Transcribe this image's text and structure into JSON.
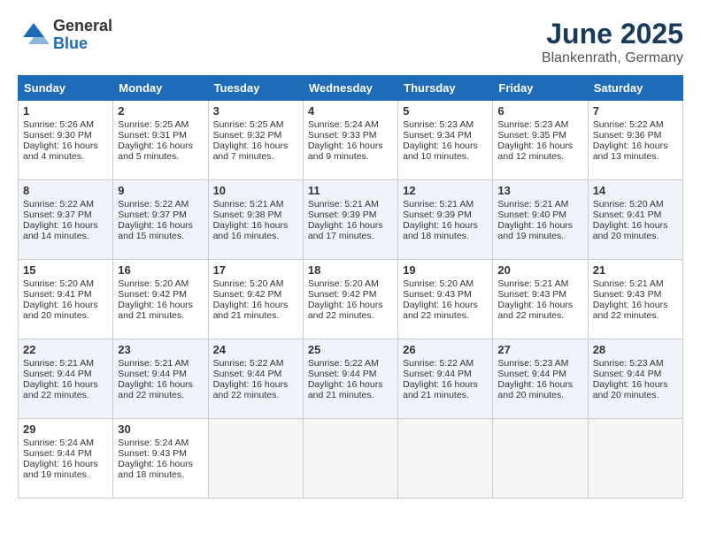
{
  "header": {
    "logo_general": "General",
    "logo_blue": "Blue",
    "month_title": "June 2025",
    "location": "Blankenrath, Germany"
  },
  "days_of_week": [
    "Sunday",
    "Monday",
    "Tuesday",
    "Wednesday",
    "Thursday",
    "Friday",
    "Saturday"
  ],
  "weeks": [
    [
      {
        "day": 1,
        "lines": [
          "Sunrise: 5:26 AM",
          "Sunset: 9:30 PM",
          "Daylight: 16 hours",
          "and 4 minutes."
        ]
      },
      {
        "day": 2,
        "lines": [
          "Sunrise: 5:25 AM",
          "Sunset: 9:31 PM",
          "Daylight: 16 hours",
          "and 5 minutes."
        ]
      },
      {
        "day": 3,
        "lines": [
          "Sunrise: 5:25 AM",
          "Sunset: 9:32 PM",
          "Daylight: 16 hours",
          "and 7 minutes."
        ]
      },
      {
        "day": 4,
        "lines": [
          "Sunrise: 5:24 AM",
          "Sunset: 9:33 PM",
          "Daylight: 16 hours",
          "and 9 minutes."
        ]
      },
      {
        "day": 5,
        "lines": [
          "Sunrise: 5:23 AM",
          "Sunset: 9:34 PM",
          "Daylight: 16 hours",
          "and 10 minutes."
        ]
      },
      {
        "day": 6,
        "lines": [
          "Sunrise: 5:23 AM",
          "Sunset: 9:35 PM",
          "Daylight: 16 hours",
          "and 12 minutes."
        ]
      },
      {
        "day": 7,
        "lines": [
          "Sunrise: 5:22 AM",
          "Sunset: 9:36 PM",
          "Daylight: 16 hours",
          "and 13 minutes."
        ]
      }
    ],
    [
      {
        "day": 8,
        "lines": [
          "Sunrise: 5:22 AM",
          "Sunset: 9:37 PM",
          "Daylight: 16 hours",
          "and 14 minutes."
        ]
      },
      {
        "day": 9,
        "lines": [
          "Sunrise: 5:22 AM",
          "Sunset: 9:37 PM",
          "Daylight: 16 hours",
          "and 15 minutes."
        ]
      },
      {
        "day": 10,
        "lines": [
          "Sunrise: 5:21 AM",
          "Sunset: 9:38 PM",
          "Daylight: 16 hours",
          "and 16 minutes."
        ]
      },
      {
        "day": 11,
        "lines": [
          "Sunrise: 5:21 AM",
          "Sunset: 9:39 PM",
          "Daylight: 16 hours",
          "and 17 minutes."
        ]
      },
      {
        "day": 12,
        "lines": [
          "Sunrise: 5:21 AM",
          "Sunset: 9:39 PM",
          "Daylight: 16 hours",
          "and 18 minutes."
        ]
      },
      {
        "day": 13,
        "lines": [
          "Sunrise: 5:21 AM",
          "Sunset: 9:40 PM",
          "Daylight: 16 hours",
          "and 19 minutes."
        ]
      },
      {
        "day": 14,
        "lines": [
          "Sunrise: 5:20 AM",
          "Sunset: 9:41 PM",
          "Daylight: 16 hours",
          "and 20 minutes."
        ]
      }
    ],
    [
      {
        "day": 15,
        "lines": [
          "Sunrise: 5:20 AM",
          "Sunset: 9:41 PM",
          "Daylight: 16 hours",
          "and 20 minutes."
        ]
      },
      {
        "day": 16,
        "lines": [
          "Sunrise: 5:20 AM",
          "Sunset: 9:42 PM",
          "Daylight: 16 hours",
          "and 21 minutes."
        ]
      },
      {
        "day": 17,
        "lines": [
          "Sunrise: 5:20 AM",
          "Sunset: 9:42 PM",
          "Daylight: 16 hours",
          "and 21 minutes."
        ]
      },
      {
        "day": 18,
        "lines": [
          "Sunrise: 5:20 AM",
          "Sunset: 9:42 PM",
          "Daylight: 16 hours",
          "and 22 minutes."
        ]
      },
      {
        "day": 19,
        "lines": [
          "Sunrise: 5:20 AM",
          "Sunset: 9:43 PM",
          "Daylight: 16 hours",
          "and 22 minutes."
        ]
      },
      {
        "day": 20,
        "lines": [
          "Sunrise: 5:21 AM",
          "Sunset: 9:43 PM",
          "Daylight: 16 hours",
          "and 22 minutes."
        ]
      },
      {
        "day": 21,
        "lines": [
          "Sunrise: 5:21 AM",
          "Sunset: 9:43 PM",
          "Daylight: 16 hours",
          "and 22 minutes."
        ]
      }
    ],
    [
      {
        "day": 22,
        "lines": [
          "Sunrise: 5:21 AM",
          "Sunset: 9:44 PM",
          "Daylight: 16 hours",
          "and 22 minutes."
        ]
      },
      {
        "day": 23,
        "lines": [
          "Sunrise: 5:21 AM",
          "Sunset: 9:44 PM",
          "Daylight: 16 hours",
          "and 22 minutes."
        ]
      },
      {
        "day": 24,
        "lines": [
          "Sunrise: 5:22 AM",
          "Sunset: 9:44 PM",
          "Daylight: 16 hours",
          "and 22 minutes."
        ]
      },
      {
        "day": 25,
        "lines": [
          "Sunrise: 5:22 AM",
          "Sunset: 9:44 PM",
          "Daylight: 16 hours",
          "and 21 minutes."
        ]
      },
      {
        "day": 26,
        "lines": [
          "Sunrise: 5:22 AM",
          "Sunset: 9:44 PM",
          "Daylight: 16 hours",
          "and 21 minutes."
        ]
      },
      {
        "day": 27,
        "lines": [
          "Sunrise: 5:23 AM",
          "Sunset: 9:44 PM",
          "Daylight: 16 hours",
          "and 20 minutes."
        ]
      },
      {
        "day": 28,
        "lines": [
          "Sunrise: 5:23 AM",
          "Sunset: 9:44 PM",
          "Daylight: 16 hours",
          "and 20 minutes."
        ]
      }
    ],
    [
      {
        "day": 29,
        "lines": [
          "Sunrise: 5:24 AM",
          "Sunset: 9:44 PM",
          "Daylight: 16 hours",
          "and 19 minutes."
        ]
      },
      {
        "day": 30,
        "lines": [
          "Sunrise: 5:24 AM",
          "Sunset: 9:43 PM",
          "Daylight: 16 hours",
          "and 18 minutes."
        ]
      },
      null,
      null,
      null,
      null,
      null
    ]
  ]
}
